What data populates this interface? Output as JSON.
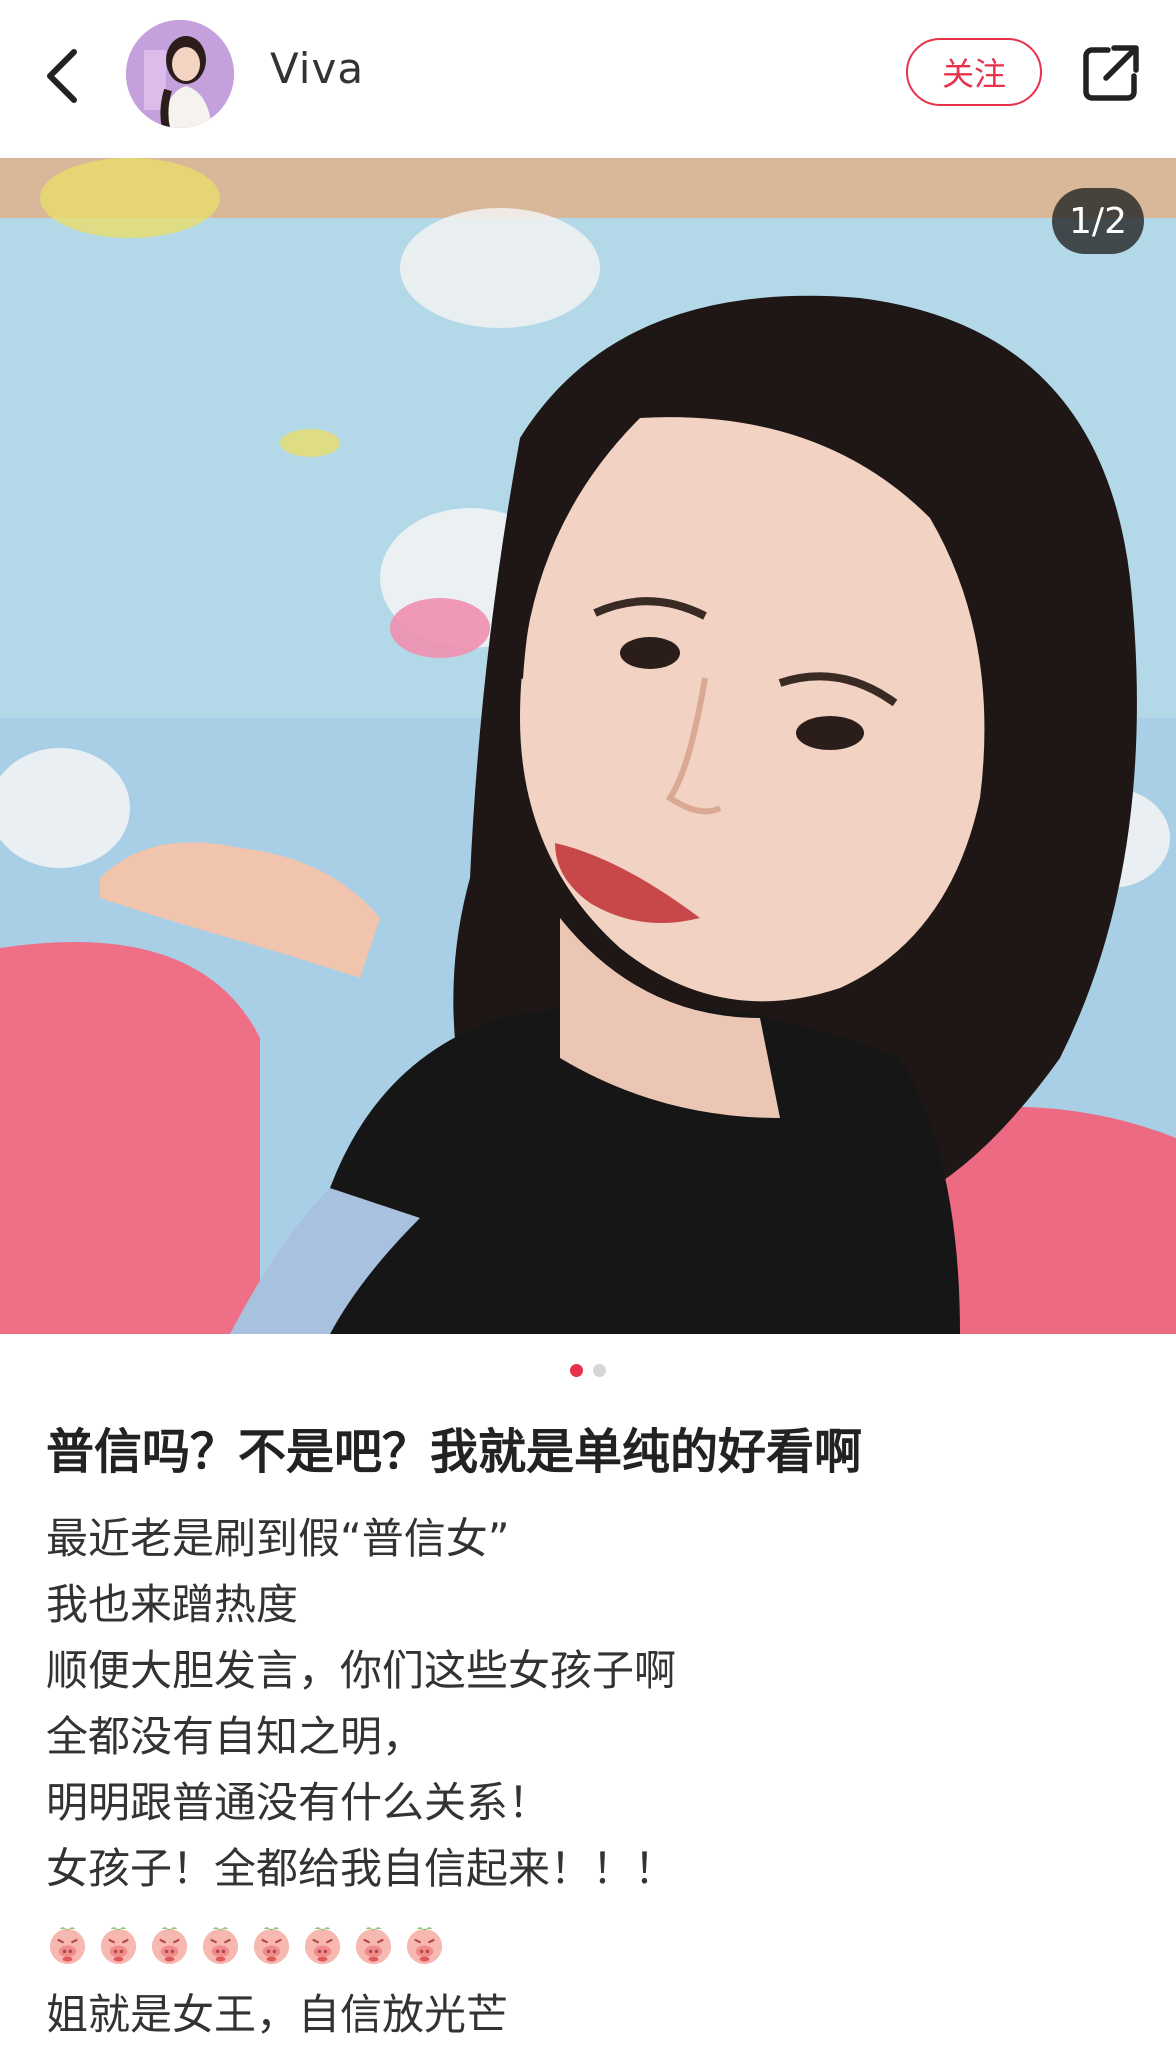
{
  "header": {
    "username": "Viva",
    "follow_label": "关注",
    "back_icon": "chevron-left-icon",
    "share_icon": "share-external-icon"
  },
  "gallery": {
    "page_indicator": "1/2",
    "current_page": 1,
    "total_pages": 2
  },
  "post": {
    "title": "普信吗？不是吧？我就是单纯的好看啊",
    "lines": [
      "最近老是刷到假“普信女”",
      "我也来蹭热度",
      "顺便大胆发言，你们这些女孩子啊",
      "全都没有自知之明，",
      "明明跟普通没有什么关系！",
      "女孩子！全都给我自信起来！！！"
    ],
    "emoji_count": 8,
    "emoji_name": "angry-pig-emoji",
    "last_line": "姐就是女王，自信放光芒"
  },
  "colors": {
    "accent": "#e8324c",
    "text": "#333333",
    "indicator_bg": "#2a2a2a"
  }
}
